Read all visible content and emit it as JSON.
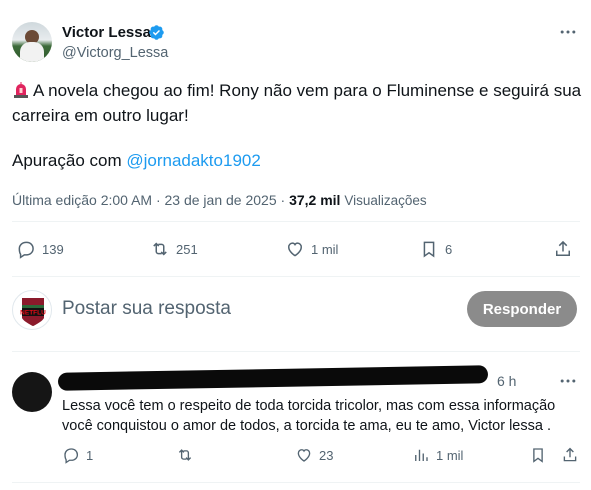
{
  "tweet": {
    "author": {
      "name": "Victor Lessa",
      "handle": "@Victorg_Lessa",
      "verified": true
    },
    "text_line": "A novela chegou ao fim! Rony não vem para o Fluminense e seguirá sua carreira em outro lugar!",
    "apuracao_prefix": "Apuração com ",
    "apuracao_mention": "@jornadakto1902",
    "meta": {
      "edited_label": "Última edição 2:00 AM · 23 de jan de 2025 · ",
      "views_count": "37,2 mil",
      "views_label": "Visualizações"
    },
    "actions": {
      "replies": "139",
      "reposts": "251",
      "likes": "1 mil",
      "bookmarks": "6"
    },
    "icons": [
      "siren-icon",
      "verified-badge-icon",
      "more-icon",
      "reply-icon",
      "repost-icon",
      "like-icon",
      "bookmark-icon",
      "share-icon",
      "views-icon"
    ]
  },
  "composer": {
    "placeholder": "Postar sua resposta",
    "button_label": "Responder"
  },
  "reply": {
    "time": "6 h",
    "text": "Lessa você tem o respeito de toda torcida tricolor, mas com essa informação você conquistou o amor de todos, a torcida te ama, eu te amo, Victor lessa .",
    "actions": {
      "replies": "1",
      "reposts": "",
      "likes": "23",
      "views": "1 mil"
    }
  },
  "colors": {
    "accent": "#1d9bf0",
    "secondary_text": "#536471",
    "button_disabled": "#8b8b8b"
  }
}
